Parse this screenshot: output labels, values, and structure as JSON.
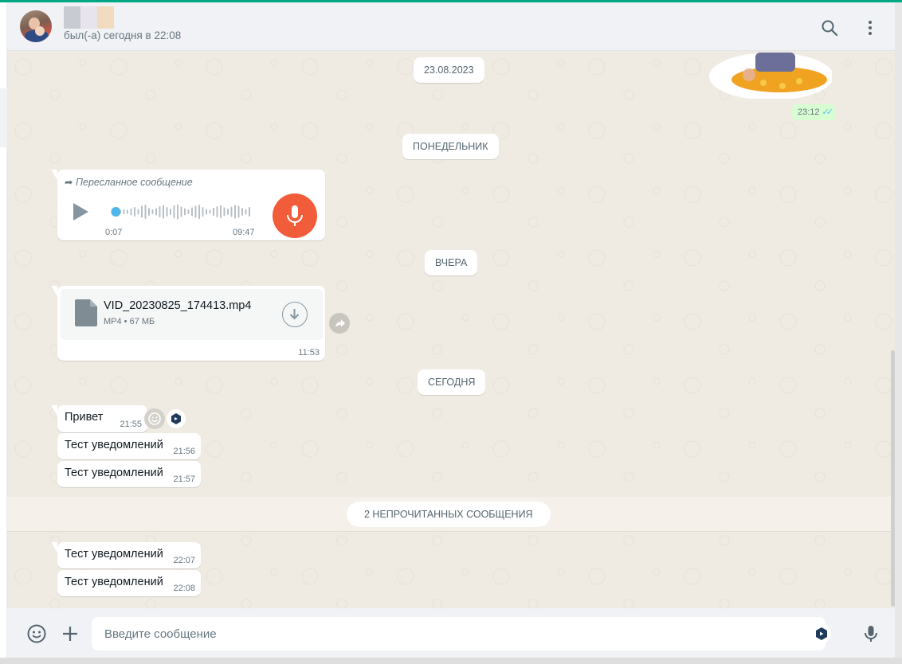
{
  "app": {
    "accent_color": "#00a884"
  },
  "header": {
    "contact_name_blurred_colors": [
      "#c8ccd2",
      "#e8e4ee",
      "#f2dcc0"
    ],
    "status": "был(-а) сегодня в 22:08",
    "search_icon": "search-icon",
    "menu_icon": "kebab-menu-icon"
  },
  "messages": {
    "sticker": {
      "time": "23:12",
      "status": "read"
    },
    "dates": {
      "d1": "23.08.2023",
      "d2": "ПОНЕДЕЛЬНИК",
      "d3": "ВЧЕРА",
      "d4": "СЕГОДНЯ"
    },
    "voice": {
      "forwarded_label": "Пересланное сообщение",
      "elapsed": "0:07",
      "duration": "09:47",
      "progress_fraction": 0.02
    },
    "file": {
      "name": "VID_20230825_174413.mp4",
      "meta": "MP4 • 67 МБ",
      "time": "11:53"
    },
    "today": [
      {
        "text": "Привет",
        "time": "21:55"
      },
      {
        "text": "Тест уведомлений",
        "time": "21:56"
      },
      {
        "text": "Тест уведомлений",
        "time": "21:57"
      }
    ],
    "unread_divider": "2 НЕПРОЧИТАННЫХ СООБЩЕНИЯ",
    "unread": [
      {
        "text": "Тест уведомлений",
        "time": "22:07"
      },
      {
        "text": "Тест уведомлений",
        "time": "22:08"
      }
    ]
  },
  "composer": {
    "placeholder": "Введите сообщение",
    "emoji_icon": "emoji-icon",
    "attach_icon": "plus-icon",
    "mic_icon": "mic-icon"
  }
}
